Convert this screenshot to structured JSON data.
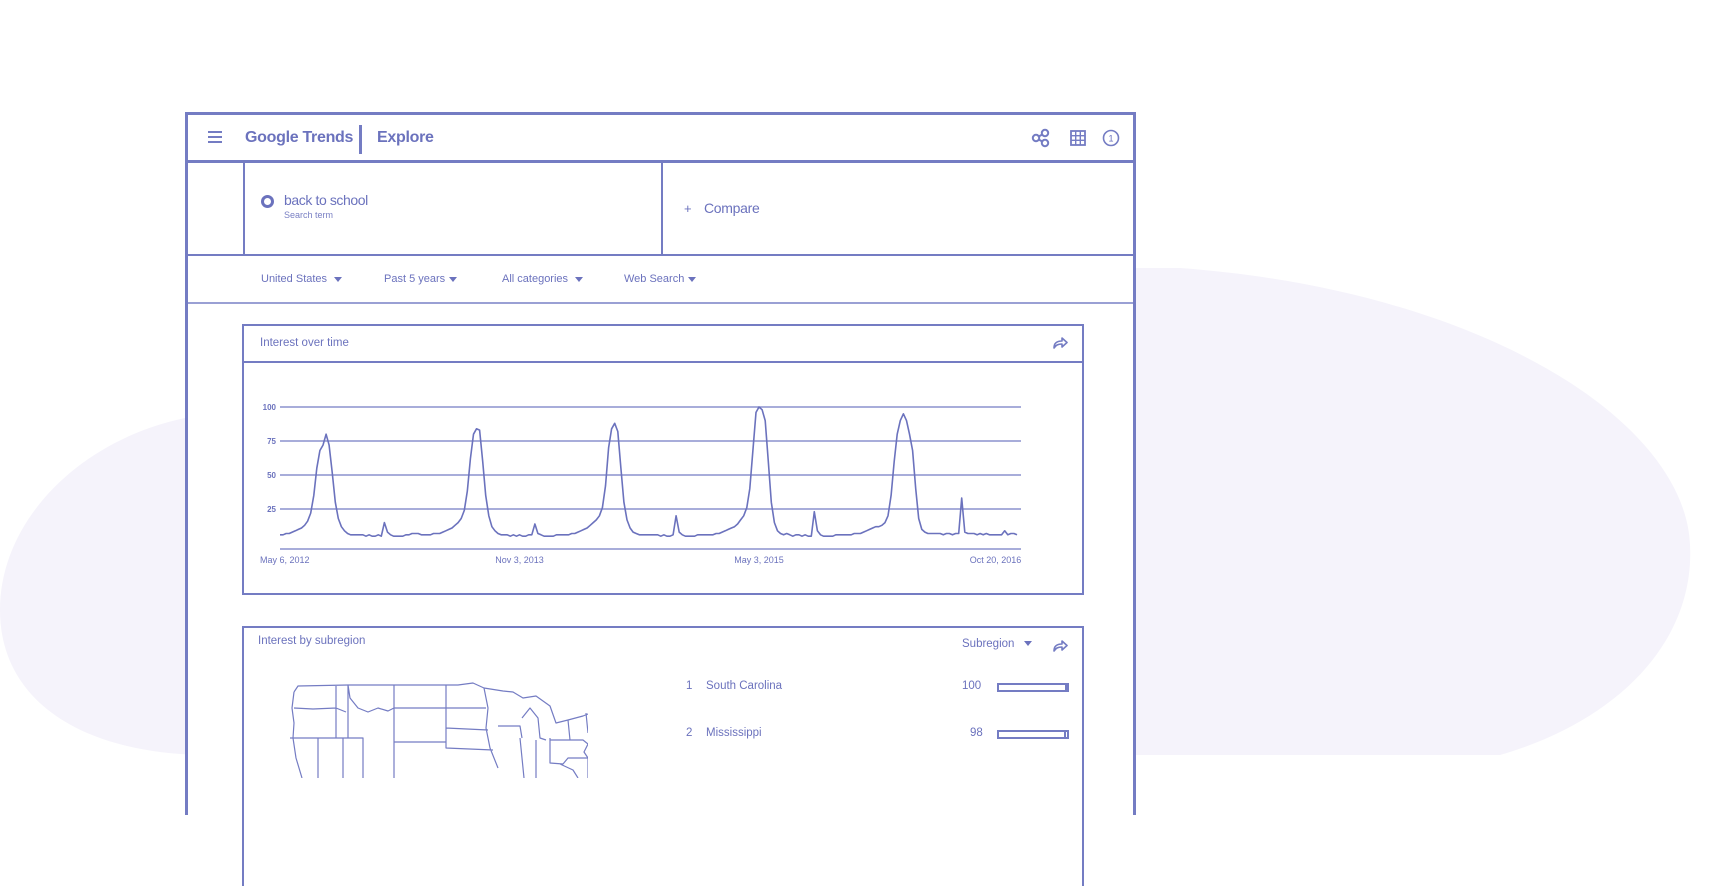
{
  "colors": {
    "accent": "#747cc3",
    "text": "#6b72bd",
    "background_blob": "#f5f3fb"
  },
  "header": {
    "brand": "Google Trends",
    "section": "Explore",
    "icons": [
      "menu-icon",
      "share-icon",
      "apps-grid-icon",
      "notifications-icon"
    ],
    "notification_count": "1"
  },
  "search": {
    "term": "back to school",
    "term_type": "Search term",
    "compare_label": "Compare",
    "compare_icon": "+"
  },
  "filters": [
    {
      "label": "United States"
    },
    {
      "label": "Past 5 years"
    },
    {
      "label": "All categories"
    },
    {
      "label": "Web Search"
    }
  ],
  "interest_over_time": {
    "title": "Interest over time"
  },
  "chart_data": {
    "type": "line",
    "title": "Interest over time",
    "xlabel": "",
    "ylabel": "",
    "ylim": [
      0,
      100
    ],
    "yticks": [
      25,
      50,
      75,
      100
    ],
    "x_tick_labels": [
      "May 6, 2012",
      "Nov 3, 2013",
      "May 3, 2015",
      "Oct 20, 2016"
    ],
    "x_tick_index": [
      0,
      78,
      156,
      233
    ],
    "grid": true,
    "series": [
      {
        "name": "back to school",
        "frequency": "weekly",
        "start": "May 6, 2012",
        "values": [
          6,
          6,
          7,
          7,
          8,
          9,
          10,
          11,
          13,
          16,
          22,
          35,
          55,
          68,
          72,
          80,
          72,
          52,
          30,
          18,
          12,
          9,
          7,
          6,
          6,
          6,
          6,
          6,
          5,
          6,
          5,
          5,
          6,
          5,
          15,
          8,
          6,
          5,
          5,
          5,
          5,
          6,
          6,
          7,
          7,
          7,
          6,
          6,
          6,
          6,
          7,
          7,
          7,
          8,
          9,
          10,
          11,
          13,
          15,
          18,
          24,
          38,
          62,
          80,
          84,
          83,
          60,
          35,
          20,
          12,
          9,
          7,
          6,
          6,
          6,
          5,
          6,
          5,
          6,
          5,
          5,
          6,
          6,
          14,
          7,
          6,
          5,
          5,
          5,
          5,
          6,
          6,
          6,
          6,
          6,
          7,
          7,
          8,
          9,
          10,
          11,
          13,
          15,
          17,
          20,
          26,
          42,
          70,
          84,
          88,
          82,
          55,
          30,
          17,
          11,
          8,
          7,
          6,
          6,
          6,
          6,
          6,
          6,
          6,
          5,
          6,
          5,
          5,
          6,
          20,
          8,
          6,
          5,
          5,
          5,
          5,
          6,
          6,
          6,
          6,
          6,
          6,
          7,
          7,
          8,
          9,
          10,
          11,
          12,
          14,
          17,
          20,
          26,
          40,
          68,
          96,
          100,
          98,
          90,
          60,
          30,
          15,
          9,
          7,
          6,
          7,
          6,
          5,
          6,
          6,
          5,
          6,
          5,
          5,
          23,
          9,
          6,
          5,
          5,
          5,
          5,
          6,
          6,
          6,
          6,
          6,
          6,
          7,
          7,
          7,
          8,
          9,
          10,
          11,
          12,
          12,
          13,
          15,
          20,
          35,
          60,
          80,
          90,
          95,
          90,
          80,
          68,
          40,
          18,
          10,
          8,
          7,
          7,
          7,
          7,
          7,
          6,
          7,
          7,
          6,
          7,
          7,
          33,
          8,
          7,
          7,
          7,
          6,
          7,
          6,
          7,
          6,
          6,
          6,
          6,
          6,
          9,
          6,
          7,
          7,
          6
        ]
      }
    ]
  },
  "interest_by_subregion": {
    "title": "Interest by subregion",
    "resolution_label": "Subregion",
    "map": "United States map",
    "rows": [
      {
        "rank": "1",
        "name": "South Carolina",
        "value": "100",
        "fraction": 1.0
      },
      {
        "rank": "2",
        "name": "Mississippi",
        "value": "98",
        "fraction": 0.98
      }
    ]
  }
}
